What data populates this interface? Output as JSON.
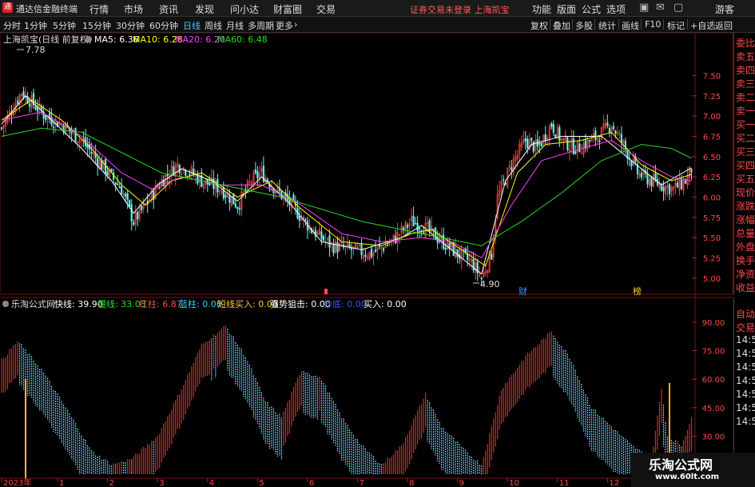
{
  "app": {
    "title": "通达信金融终端",
    "logo": "通"
  },
  "menu": [
    "行情",
    "市场",
    "资讯",
    "发现",
    "问小达",
    "财富圈",
    "交易"
  ],
  "notice": "证券交易未登录  上海凯宝",
  "right_menu": [
    "功能",
    "版面",
    "公式",
    "选项"
  ],
  "guest": "游客",
  "toolbar": {
    "periods": [
      "分时",
      "1分钟",
      "5分钟",
      "15分钟",
      "30分钟",
      "60分钟",
      "日线",
      "周线",
      "月线",
      "多周期",
      "更多"
    ],
    "active": "日线",
    "right_buttons": [
      "复权",
      "叠加",
      "多股",
      "统计",
      "画线",
      "F10",
      "标记",
      "+自选",
      "返回"
    ]
  },
  "price_panel": {
    "header": "上海凯宝(日线 前复权)",
    "ma": [
      {
        "label": "MA5: 6.36",
        "color": "#ffffff"
      },
      {
        "label": "MA10: 6.28",
        "color": "#ffff00"
      },
      {
        "label": "MA20: 6.20",
        "color": "#ff40ff"
      },
      {
        "label": "MA60: 6.48",
        "color": "#22dd22"
      }
    ],
    "high_label": "7.78",
    "low_label": "4.90",
    "event_marks": [
      {
        "text": "财",
        "x": 198,
        "color": "#3399ff"
      },
      {
        "text": "榜",
        "x": 245,
        "color": "#ffcc33"
      }
    ]
  },
  "indicator_panel": {
    "name": "乐淘公式网",
    "items": [
      {
        "label": "快线: 39.90",
        "color": "#ffffff"
      },
      {
        "label": "慢线: 33.03",
        "color": "#22dd22"
      },
      {
        "label": "红柱: 6.87",
        "color": "#ff4a4a"
      },
      {
        "label": "蓝柱: 0.00",
        "color": "#33ccff"
      },
      {
        "label": "短线买入: 0.00",
        "color": "#ffcc33"
      },
      {
        "label": "强势狙击: 0.00",
        "color": "#ffffff"
      },
      {
        "label": "抄底: 0.00",
        "color": "#3355ff"
      },
      {
        "label": "买入: 0.00",
        "color": "#ffffff"
      }
    ]
  },
  "side_panel_top": [
    "委比",
    "卖五",
    "卖四",
    "卖三",
    "卖二",
    "卖一",
    "买一",
    "买二",
    "买三",
    "买四",
    "买五",
    "现价",
    "涨跌",
    "涨幅",
    "总量",
    "外盘",
    "换手",
    "净资",
    "收益"
  ],
  "side_panel_bottom": [
    "自动",
    "交易",
    "14:56",
    "14:56",
    "14:56",
    "14:56",
    "14:56",
    "14:56",
    "14:56"
  ],
  "watermark": {
    "title": "乐淘公式网",
    "url": "www.60lt.com"
  },
  "chart_data": [
    {
      "type": "candlestick",
      "title": "上海凯宝(日线 前复权)",
      "ylim": [
        4.85,
        7.85
      ],
      "yticks": [
        5.0,
        5.25,
        5.5,
        5.75,
        6.0,
        6.25,
        6.5,
        6.75,
        7.0,
        7.25,
        7.5
      ],
      "ytick_labels": [
        "5.00",
        "5.25",
        "5.50",
        "5.75",
        "6.00",
        "6.25",
        "6.50",
        "6.75",
        "7.00",
        "7.25",
        "7.50"
      ],
      "close_keypoints": [
        [
          0,
          6.85
        ],
        [
          10,
          7.3
        ],
        [
          22,
          7.0
        ],
        [
          30,
          6.9
        ],
        [
          40,
          6.7
        ],
        [
          50,
          6.4
        ],
        [
          60,
          6.1
        ],
        [
          66,
          5.7
        ],
        [
          72,
          5.9
        ],
        [
          80,
          6.2
        ],
        [
          88,
          6.4
        ],
        [
          95,
          6.3
        ],
        [
          100,
          6.2
        ],
        [
          110,
          6.1
        ],
        [
          118,
          5.9
        ],
        [
          125,
          6.2
        ],
        [
          130,
          6.3
        ],
        [
          137,
          6.1
        ],
        [
          145,
          5.9
        ],
        [
          155,
          5.6
        ],
        [
          165,
          5.4
        ],
        [
          175,
          5.35
        ],
        [
          185,
          5.3
        ],
        [
          195,
          5.45
        ],
        [
          205,
          5.7
        ],
        [
          210,
          5.65
        ],
        [
          218,
          5.5
        ],
        [
          228,
          5.3
        ],
        [
          235,
          5.2
        ],
        [
          240,
          5.0
        ],
        [
          245,
          5.3
        ],
        [
          248,
          6.0
        ],
        [
          255,
          6.4
        ],
        [
          262,
          6.7
        ],
        [
          268,
          6.6
        ],
        [
          275,
          6.9
        ],
        [
          280,
          6.7
        ],
        [
          288,
          6.6
        ],
        [
          298,
          6.75
        ],
        [
          305,
          6.9
        ],
        [
          312,
          6.6
        ],
        [
          318,
          6.3
        ],
        [
          325,
          6.2
        ],
        [
          330,
          6.15
        ],
        [
          336,
          6.1
        ],
        [
          342,
          6.2
        ],
        [
          345,
          6.35
        ]
      ],
      "ma_series": [
        {
          "name": "MA5",
          "color": "#ffffff",
          "points": [
            [
              0,
              6.9
            ],
            [
              12,
              7.25
            ],
            [
              25,
              6.95
            ],
            [
              40,
              6.6
            ],
            [
              55,
              6.2
            ],
            [
              66,
              5.8
            ],
            [
              78,
              6.15
            ],
            [
              90,
              6.35
            ],
            [
              105,
              6.2
            ],
            [
              118,
              5.95
            ],
            [
              130,
              6.25
            ],
            [
              145,
              5.9
            ],
            [
              160,
              5.45
            ],
            [
              180,
              5.35
            ],
            [
              200,
              5.5
            ],
            [
              210,
              5.65
            ],
            [
              225,
              5.35
            ],
            [
              240,
              5.05
            ],
            [
              252,
              6.2
            ],
            [
              265,
              6.65
            ],
            [
              280,
              6.75
            ],
            [
              300,
              6.75
            ],
            [
              315,
              6.45
            ],
            [
              330,
              6.15
            ],
            [
              345,
              6.36
            ]
          ]
        },
        {
          "name": "MA10",
          "color": "#ffff00",
          "points": [
            [
              0,
              6.95
            ],
            [
              15,
              7.2
            ],
            [
              30,
              6.95
            ],
            [
              45,
              6.6
            ],
            [
              60,
              6.15
            ],
            [
              72,
              5.9
            ],
            [
              85,
              6.2
            ],
            [
              100,
              6.3
            ],
            [
              118,
              6.0
            ],
            [
              135,
              6.2
            ],
            [
              150,
              5.85
            ],
            [
              170,
              5.45
            ],
            [
              190,
              5.4
            ],
            [
              205,
              5.55
            ],
            [
              215,
              5.6
            ],
            [
              230,
              5.35
            ],
            [
              242,
              5.15
            ],
            [
              258,
              6.3
            ],
            [
              272,
              6.65
            ],
            [
              290,
              6.7
            ],
            [
              305,
              6.8
            ],
            [
              320,
              6.4
            ],
            [
              335,
              6.2
            ],
            [
              345,
              6.28
            ]
          ]
        },
        {
          "name": "MA20",
          "color": "#ff40ff",
          "points": [
            [
              0,
              6.95
            ],
            [
              20,
              7.05
            ],
            [
              40,
              6.75
            ],
            [
              60,
              6.3
            ],
            [
              75,
              6.1
            ],
            [
              90,
              6.25
            ],
            [
              110,
              6.15
            ],
            [
              130,
              6.15
            ],
            [
              150,
              5.9
            ],
            [
              170,
              5.55
            ],
            [
              190,
              5.45
            ],
            [
              210,
              5.5
            ],
            [
              225,
              5.45
            ],
            [
              240,
              5.25
            ],
            [
              255,
              5.9
            ],
            [
              270,
              6.45
            ],
            [
              290,
              6.6
            ],
            [
              305,
              6.7
            ],
            [
              320,
              6.45
            ],
            [
              335,
              6.25
            ],
            [
              345,
              6.2
            ]
          ]
        },
        {
          "name": "MA60",
          "color": "#22dd22",
          "points": [
            [
              0,
              6.75
            ],
            [
              20,
              6.85
            ],
            [
              40,
              6.8
            ],
            [
              60,
              6.55
            ],
            [
              80,
              6.3
            ],
            [
              100,
              6.2
            ],
            [
              120,
              6.1
            ],
            [
              140,
              6.0
            ],
            [
              160,
              5.85
            ],
            [
              180,
              5.7
            ],
            [
              200,
              5.6
            ],
            [
              220,
              5.5
            ],
            [
              240,
              5.4
            ],
            [
              260,
              5.7
            ],
            [
              280,
              6.05
            ],
            [
              300,
              6.45
            ],
            [
              320,
              6.65
            ],
            [
              335,
              6.6
            ],
            [
              345,
              6.48
            ]
          ]
        }
      ]
    },
    {
      "type": "area",
      "title": "乐淘公式网",
      "ylim": [
        10,
        95
      ],
      "yticks": [
        15,
        30,
        45,
        60,
        75,
        90
      ],
      "ytick_labels": [
        "15.00",
        "30.00",
        "45.00",
        "60.00",
        "75.00",
        "90.00"
      ],
      "fast_keypoints": [
        [
          0,
          70
        ],
        [
          8,
          80
        ],
        [
          20,
          65
        ],
        [
          35,
          40
        ],
        [
          45,
          22
        ],
        [
          55,
          15
        ],
        [
          65,
          18
        ],
        [
          78,
          30
        ],
        [
          90,
          55
        ],
        [
          100,
          78
        ],
        [
          112,
          88
        ],
        [
          122,
          72
        ],
        [
          132,
          48
        ],
        [
          140,
          40
        ],
        [
          150,
          65
        ],
        [
          160,
          60
        ],
        [
          170,
          40
        ],
        [
          180,
          25
        ],
        [
          190,
          15
        ],
        [
          200,
          25
        ],
        [
          212,
          52
        ],
        [
          220,
          35
        ],
        [
          232,
          22
        ],
        [
          240,
          15
        ],
        [
          250,
          55
        ],
        [
          262,
          72
        ],
        [
          275,
          85
        ],
        [
          285,
          70
        ],
        [
          295,
          45
        ],
        [
          305,
          35
        ],
        [
          315,
          25
        ],
        [
          325,
          18
        ],
        [
          330,
          55
        ],
        [
          333,
          30
        ],
        [
          340,
          25
        ],
        [
          345,
          40
        ]
      ],
      "buy_signals": [
        {
          "x": 12,
          "value": 60
        },
        {
          "x": 334,
          "value": 58
        }
      ],
      "xticks": [
        {
          "x": 0,
          "label": "2023年"
        },
        {
          "x": 28,
          "label": "1"
        },
        {
          "x": 53,
          "label": "2"
        },
        {
          "x": 78,
          "label": "3"
        },
        {
          "x": 103,
          "label": "4"
        },
        {
          "x": 128,
          "label": "5"
        },
        {
          "x": 153,
          "label": "6"
        },
        {
          "x": 178,
          "label": "7"
        },
        {
          "x": 203,
          "label": "8"
        },
        {
          "x": 228,
          "label": "9"
        },
        {
          "x": 253,
          "label": "10"
        },
        {
          "x": 278,
          "label": "11"
        },
        {
          "x": 303,
          "label": "12"
        }
      ]
    }
  ]
}
